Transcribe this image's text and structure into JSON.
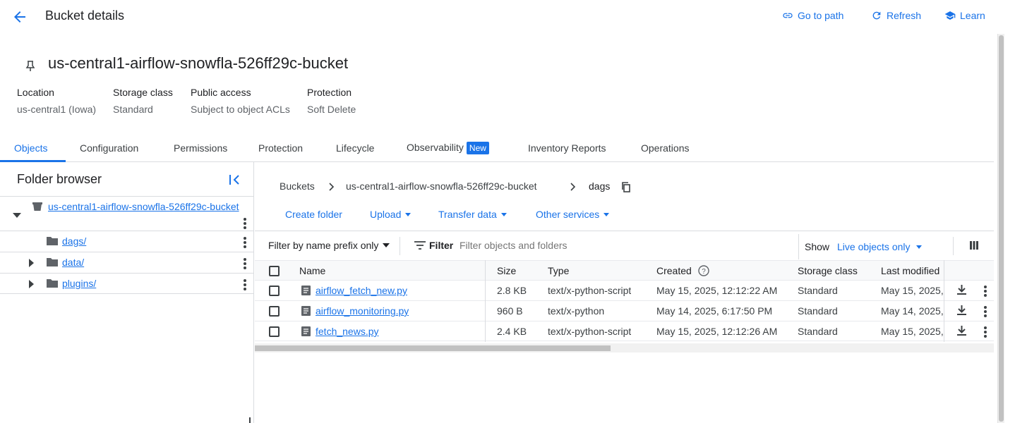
{
  "header": {
    "title": "Bucket details",
    "go_to_path": "Go to path",
    "refresh": "Refresh",
    "learn": "Learn"
  },
  "bucket": {
    "name": "us-central1-airflow-snowfla-526ff29c-bucket",
    "meta": [
      {
        "key": "Location",
        "value": "us-central1 (Iowa)"
      },
      {
        "key": "Storage class",
        "value": "Standard"
      },
      {
        "key": "Public access",
        "value": "Subject to object ACLs"
      },
      {
        "key": "Protection",
        "value": "Soft Delete"
      }
    ]
  },
  "tabs": [
    "Objects",
    "Configuration",
    "Permissions",
    "Protection",
    "Lifecycle",
    "Observability",
    "Inventory Reports",
    "Operations"
  ],
  "tab_badge": "New",
  "folder_browser": {
    "title": "Folder browser",
    "root": "us-central1-airflow-snowfla-526ff29c-bucket",
    "folders": [
      "dags/",
      "data/",
      "plugins/"
    ]
  },
  "breadcrumb": {
    "buckets": "Buckets",
    "bucket": "us-central1-airflow-snowfla-526ff29c-bucket",
    "current": "dags"
  },
  "actions": {
    "create_folder": "Create folder",
    "upload": "Upload",
    "transfer_data": "Transfer data",
    "other_services": "Other services"
  },
  "filter": {
    "prefix_label": "Filter by name prefix only",
    "filter_label": "Filter",
    "placeholder": "Filter objects and folders",
    "show_label": "Show",
    "show_value": "Live objects only"
  },
  "table": {
    "columns": [
      "Name",
      "Size",
      "Type",
      "Created",
      "Storage class",
      "Last modified"
    ],
    "rows": [
      {
        "name": "airflow_fetch_new.py",
        "size": "2.8 KB",
        "type": "text/x-python-script",
        "created": "May 15, 2025, 12:12:22 AM",
        "storage": "Standard",
        "modified": "May 15, 2025,"
      },
      {
        "name": "airflow_monitoring.py",
        "size": "960 B",
        "type": "text/x-python",
        "created": "May 14, 2025, 6:17:50 PM",
        "storage": "Standard",
        "modified": "May 14, 2025,"
      },
      {
        "name": "fetch_news.py",
        "size": "2.4 KB",
        "type": "text/x-python-script",
        "created": "May 15, 2025, 12:12:26 AM",
        "storage": "Standard",
        "modified": "May 15, 2025,"
      }
    ]
  },
  "colors": {
    "accent": "#1a73e8"
  }
}
